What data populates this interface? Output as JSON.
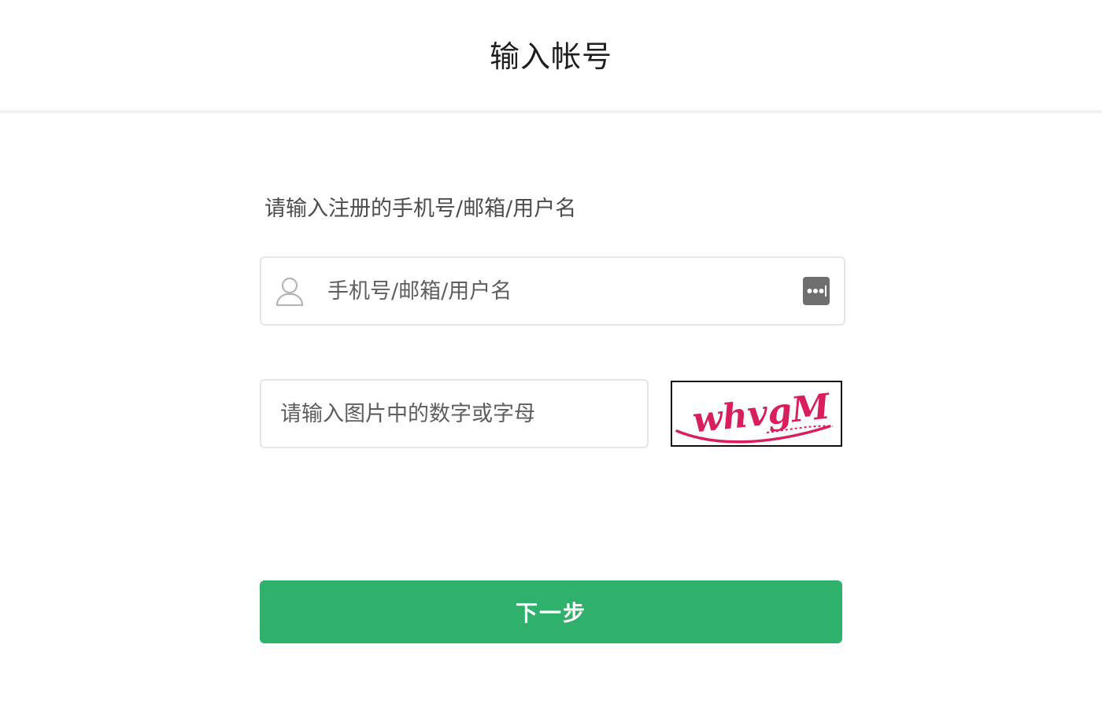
{
  "header": {
    "title": "输入帐号"
  },
  "form": {
    "prompt": "请输入注册的手机号/邮箱/用户名",
    "account": {
      "value": "",
      "placeholder": "手机号/邮箱/用户名",
      "leading_icon": "user-icon",
      "trailing_icon": "more-options-icon"
    },
    "captcha": {
      "value": "",
      "placeholder": "请输入图片中的数字或字母",
      "image_text": "whvgM"
    },
    "next_label": "下一步"
  },
  "colors": {
    "accent": "#2fb06b",
    "captcha_text": "#d81e5b",
    "border": "#e5e5e5"
  }
}
